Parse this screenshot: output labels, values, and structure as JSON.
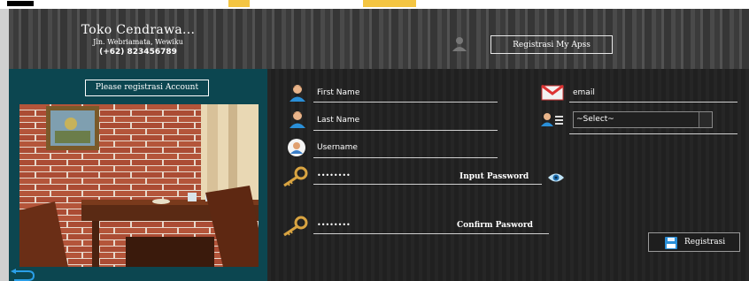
{
  "header": {
    "shop_name": "Toko Cendrawa...",
    "address": "Jln. Webriamata, Wewiku",
    "phone": "(+62) 823456789",
    "title_button": "Registrasi My Apss"
  },
  "left_panel": {
    "register_button": "Please registrasi Account",
    "photo_icon": "restaurant-interior-photo"
  },
  "form": {
    "first_name_label": "First Name",
    "last_name_label": "Last Name",
    "username_label": "Username",
    "email_label": "email",
    "role_select_value": "~Select~",
    "password_value": "••••••••",
    "password_hint": "Input Password",
    "confirm_value": "••••••••",
    "confirm_hint": "Confirm Pasword",
    "submit_label": "Registrasi"
  },
  "icons": {
    "user": "user-icon",
    "mail": "mail-icon",
    "roles": "user-list-icon",
    "account": "account-circle-icon",
    "key": "key-icon",
    "eye": "eye-icon",
    "save": "floppy-disk-icon",
    "back": "back-arrow-icon"
  },
  "colors": {
    "left_panel": "#0c4650",
    "background": "#222222",
    "accent_blue": "#2a8fd8"
  }
}
